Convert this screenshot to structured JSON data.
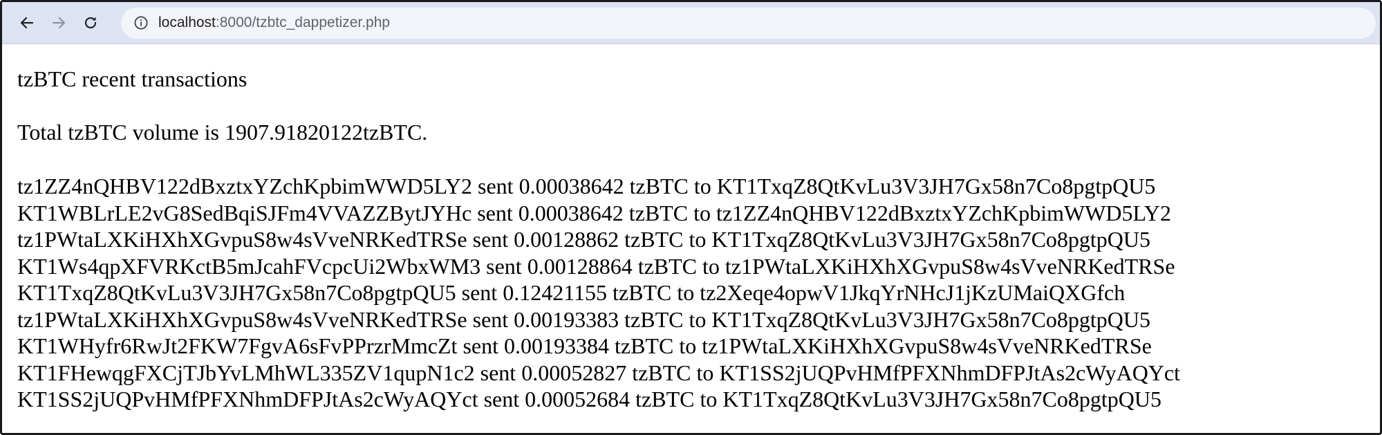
{
  "browser": {
    "url_host": "localhost",
    "url_path": ":8000/tzbtc_dappetizer.php"
  },
  "page": {
    "heading": "tzBTC recent transactions",
    "total_text": "Total tzBTC volume is 1907.91820122tzBTC.",
    "transactions": [
      "tz1ZZ4nQHBV122dBxztxYZchKpbimWWD5LY2 sent 0.00038642 tzBTC to KT1TxqZ8QtKvLu3V3JH7Gx58n7Co8pgtpQU5",
      "KT1WBLrLE2vG8SedBqiSJFm4VVAZZBytJYHc sent 0.00038642 tzBTC to tz1ZZ4nQHBV122dBxztxYZchKpbimWWD5LY2",
      "tz1PWtaLXKiHXhXGvpuS8w4sVveNRKedTRSe sent 0.00128862 tzBTC to KT1TxqZ8QtKvLu3V3JH7Gx58n7Co8pgtpQU5",
      "KT1Ws4qpXFVRKctB5mJcahFVcpcUi2WbxWM3 sent 0.00128864 tzBTC to tz1PWtaLXKiHXhXGvpuS8w4sVveNRKedTRSe",
      "KT1TxqZ8QtKvLu3V3JH7Gx58n7Co8pgtpQU5 sent 0.12421155 tzBTC to tz2Xeqe4opwV1JkqYrNHcJ1jKzUMaiQXGfch",
      "tz1PWtaLXKiHXhXGvpuS8w4sVveNRKedTRSe sent 0.00193383 tzBTC to KT1TxqZ8QtKvLu3V3JH7Gx58n7Co8pgtpQU5",
      "KT1WHyfr6RwJt2FKW7FgvA6sFvPPrzrMmcZt sent 0.00193384 tzBTC to tz1PWtaLXKiHXhXGvpuS8w4sVveNRKedTRSe",
      "KT1FHewqgFXCjTJbYvLMhWL335ZV1qupN1c2 sent 0.00052827 tzBTC to KT1SS2jUQPvHMfPFXNhmDFPJtAs2cWyAQYct",
      "KT1SS2jUQPvHMfPFXNhmDFPJtAs2cWyAQYct sent 0.00052684 tzBTC to KT1TxqZ8QtKvLu3V3JH7Gx58n7Co8pgtpQU5"
    ]
  },
  "icons": {
    "back": "arrow-left-icon",
    "forward": "arrow-right-icon",
    "reload": "reload-icon",
    "site_info": "info-icon"
  },
  "colors": {
    "toolbar_bg": "#dde3f3",
    "omnibox_bg": "#f3f5fb",
    "forward_disabled": "#9aa0a6"
  }
}
